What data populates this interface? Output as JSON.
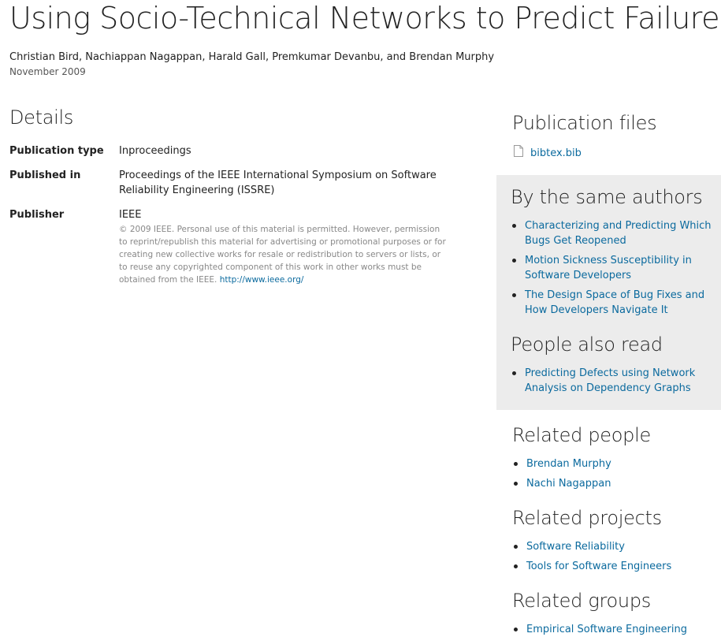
{
  "header": {
    "title": "Using Socio-Technical Networks to Predict Failures",
    "authors": "Christian Bird, Nachiappan Nagappan, Harald Gall, Premkumar Devanbu, and Brendan Murphy",
    "date": "November 2009"
  },
  "details": {
    "heading": "Details",
    "rows": [
      {
        "key": "Publication type",
        "value": "Inproceedings"
      },
      {
        "key": "Published in",
        "value": "Proceedings of the IEEE International Symposium on Software Reliability Engineering (ISSRE)"
      },
      {
        "key": "Publisher",
        "value": "IEEE"
      }
    ],
    "copyright": "© 2009 IEEE. Personal use of this material is permitted. However, permission to reprint/republish this material for advertising or promotional purposes or for creating new collective works for resale or redistribution to servers or lists, or to reuse any copyrighted component of this work in other works must be obtained from the IEEE.",
    "copyright_link": "http://www.ieee.org/"
  },
  "publication_files": {
    "heading": "Publication files",
    "file_label": "bibtex.bib",
    "file_icon": "document-icon"
  },
  "same_authors": {
    "heading": "By the same authors",
    "items": [
      "Characterizing and Predicting Which Bugs Get Reopened",
      "Motion Sickness Susceptibility in Software Developers",
      "The Design Space of Bug Fixes and How Developers Navigate It"
    ]
  },
  "people_also_read": {
    "heading": "People also read",
    "items": [
      "Predicting Defects using Network Analysis on Dependency Graphs"
    ]
  },
  "related_people": {
    "heading": "Related people",
    "items": [
      "Brendan Murphy",
      "Nachi Nagappan"
    ]
  },
  "related_projects": {
    "heading": "Related projects",
    "items": [
      "Software Reliability",
      "Tools for Software Engineers"
    ]
  },
  "related_groups": {
    "heading": "Related groups",
    "items": [
      "Empirical Software Engineering"
    ]
  },
  "colors": {
    "link": "#0b6a9e",
    "sidebar_bg": "#ececec"
  }
}
